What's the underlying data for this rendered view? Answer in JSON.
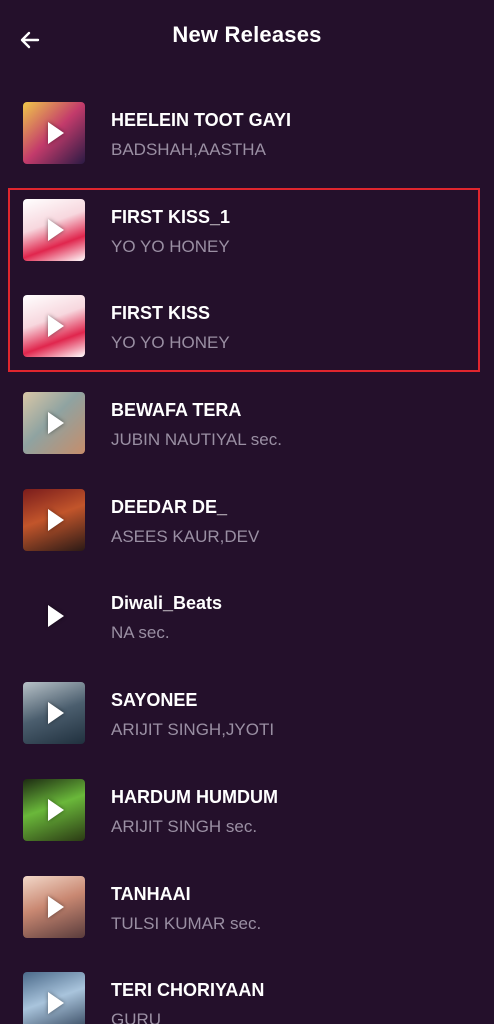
{
  "header": {
    "title": "New Releases",
    "back_icon": "arrow-left-icon"
  },
  "songs": [
    {
      "title": "HEELEIN TOOT GAYI",
      "artist": "BADSHAH,AASTHA",
      "art": "linear-gradient(135deg,#f0c84a 0%,#c33b6b 50%,#2a1a44 100%)"
    },
    {
      "title": "FIRST KISS_1",
      "artist": "YO YO HONEY",
      "art": "linear-gradient(160deg,#ffffff 0%,#f7d7de 40%,#e0264d 70%,#ffffff 100%)"
    },
    {
      "title": "FIRST KISS",
      "artist": "YO YO HONEY",
      "art": "linear-gradient(160deg,#ffffff 0%,#f7d7de 40%,#e0264d 70%,#ffffff 100%)"
    },
    {
      "title": "BEWAFA TERA",
      "artist": "JUBIN NAUTIYAL sec.",
      "art": "linear-gradient(135deg,#d9c7a7 0%,#8fa3a1 45%,#c68d6b 100%)"
    },
    {
      "title": "DEEDAR DE_",
      "artist": "ASEES KAUR,DEV",
      "art": "linear-gradient(160deg,#7a1c1c 0%,#c2552b 45%,#2b1a16 100%)"
    },
    {
      "title": "Diwali_Beats",
      "artist": "NA sec.",
      "art": "transparent"
    },
    {
      "title": "SAYONEE",
      "artist": "ARIJIT SINGH,JYOTI",
      "art": "linear-gradient(160deg,#b8c2c8 0%,#4b5e6e 50%,#20303e 100%)"
    },
    {
      "title": "HARDUM HUMDUM",
      "artist": "ARIJIT SINGH sec.",
      "art": "linear-gradient(160deg,#1d2b12 0%,#6ab83a 45%,#2b3a14 100%)"
    },
    {
      "title": "TANHAAI",
      "artist": "TULSI KUMAR sec.",
      "art": "linear-gradient(160deg,#f2d8c9 0%,#c98872 45%,#5a3c3c 100%)"
    },
    {
      "title": "TERI CHORIYAAN",
      "artist": "GURU",
      "art": "linear-gradient(160deg,#4b6a8a 0%,#a9c4dc 45%,#2a3b52 100%)"
    }
  ],
  "colors": {
    "background": "#24102b",
    "highlight": "#e0262e",
    "subtitle": "#9a8fa3"
  }
}
